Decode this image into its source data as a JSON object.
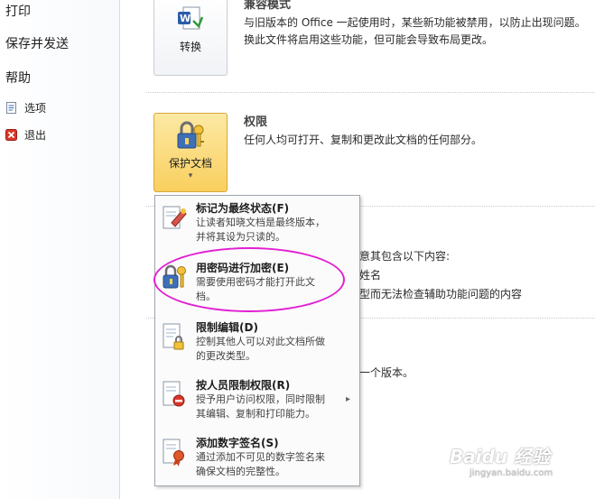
{
  "sidebar": {
    "print": "打印",
    "save_send": "保存并发送",
    "help": "帮助",
    "options": "选项",
    "exit": "退出"
  },
  "compat": {
    "title": "兼容模式",
    "desc_line1": "与旧版本的 Office 一起使用时，某些新功能被禁用，以防止出现问题。",
    "desc_line2": "换此文件将启用这些功能，但可能会导致布局更改。",
    "button_label": "转换"
  },
  "permissions": {
    "title": "权限",
    "desc": "任何人均可打开、复制和更改此文档的任何部分。",
    "button_label": "保护文档",
    "button_arrow": "▾"
  },
  "prepare": {
    "line1": "意其包含以下内容:",
    "line2": "姓名",
    "line3": "型而无法检查辅助功能问题的内容"
  },
  "versions": {
    "line1": "一个版本。"
  },
  "menu": {
    "items": [
      {
        "title": "标记为最终状态(F)",
        "desc": "让读者知晓文档是最终版本，\n并将其设为只读的。",
        "icon": "mark-final-icon"
      },
      {
        "title": "用密码进行加密(E)",
        "desc": "需要使用密码才能打开此文\n档。",
        "icon": "key-lock-icon"
      },
      {
        "title": "限制编辑(D)",
        "desc": "控制其他人可以对此文档所做\n的更改类型。",
        "icon": "restrict-edit-icon"
      },
      {
        "title": "按人员限制权限(R)",
        "desc": "授予用户访问权限，同时限制\n其编辑、复制和打印能力。",
        "icon": "restrict-permission-icon"
      },
      {
        "title": "添加数字签名(S)",
        "desc": "通过添加不可见的数字签名来\n确保文档的完整性。",
        "icon": "digital-signature-icon"
      }
    ],
    "submenu_arrow": "▸"
  },
  "watermark": {
    "brand": "Baidu 经验",
    "url": "jingyan.baidu.com"
  }
}
